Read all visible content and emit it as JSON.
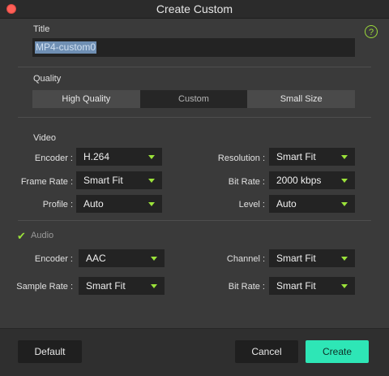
{
  "window": {
    "title": "Create Custom"
  },
  "help": {
    "label": "?"
  },
  "title_section": {
    "label": "Title",
    "value": "MP4-custom0"
  },
  "quality": {
    "label": "Quality",
    "options": [
      "High Quality",
      "Custom",
      "Small Size"
    ],
    "selected": "Custom"
  },
  "video": {
    "label": "Video",
    "encoder": {
      "label": "Encoder :",
      "value": "H.264"
    },
    "frame_rate": {
      "label": "Frame Rate :",
      "value": "Smart Fit"
    },
    "profile": {
      "label": "Profile :",
      "value": "Auto"
    },
    "resolution": {
      "label": "Resolution :",
      "value": "Smart Fit"
    },
    "bit_rate": {
      "label": "Bit Rate :",
      "value": "2000 kbps"
    },
    "level": {
      "label": "Level :",
      "value": "Auto"
    }
  },
  "audio": {
    "label": "Audio",
    "checked": true,
    "encoder": {
      "label": "Encoder :",
      "value": "AAC"
    },
    "sample_rate": {
      "label": "Sample Rate :",
      "value": "Smart Fit"
    },
    "channel": {
      "label": "Channel :",
      "value": "Smart Fit"
    },
    "bit_rate": {
      "label": "Bit Rate :",
      "value": "Smart Fit"
    }
  },
  "footer": {
    "default_label": "Default",
    "cancel_label": "Cancel",
    "create_label": "Create"
  },
  "colors": {
    "accent": "#2ee6b6",
    "caret": "#9be23a",
    "close": "#ff5f57"
  }
}
